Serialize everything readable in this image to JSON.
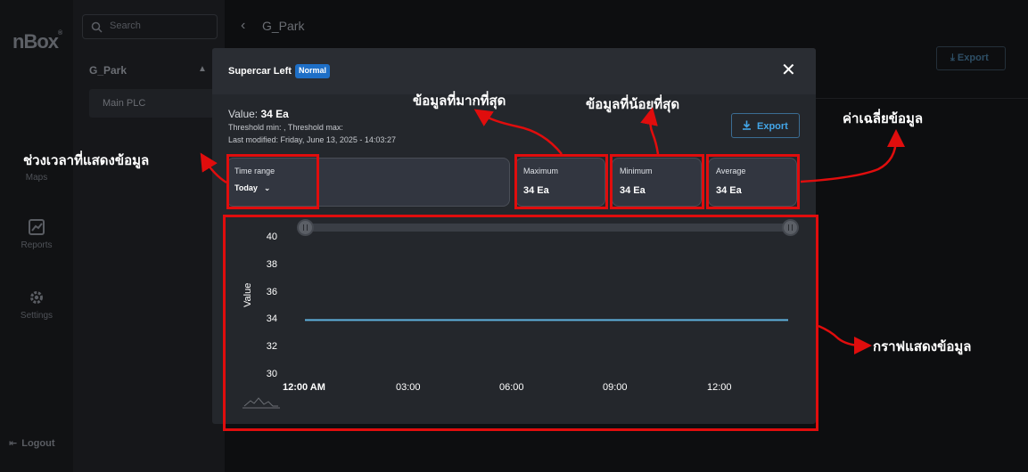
{
  "app": {
    "logo": "nBox",
    "logo_mark": "®",
    "rail": [
      {
        "label": "Maps",
        "icon": "map-icon"
      },
      {
        "label": "Reports",
        "icon": "chart-icon"
      },
      {
        "label": "Settings",
        "icon": "gear-icon"
      }
    ],
    "logout_label": "Logout"
  },
  "sidebar": {
    "search_placeholder": "Search",
    "group": "G_Park",
    "item": "Main PLC"
  },
  "topbar": {
    "title": "G_Park",
    "export_label": "Export"
  },
  "modal": {
    "title": "Supercar Left",
    "status_badge": "Normal",
    "value_prefix": "Value:",
    "value": "34 Ea",
    "threshold": "Threshold min: , Threshold max:",
    "last_modified": "Last modified: Friday, June 13, 2025 - 14:03:27",
    "export_label": "Export",
    "time_range_label": "Time range",
    "time_range_value": "Today",
    "maximum_label": "Maximum",
    "maximum_value": "34 Ea",
    "minimum_label": "Minimum",
    "minimum_value": "34 Ea",
    "average_label": "Average",
    "average_value": "34 Ea"
  },
  "annotations": {
    "time_range": "ช่วงเวลาที่แสดงข้อมูล",
    "maximum": "ข้อมูลที่มากที่สุด",
    "minimum": "ข้อมูลที่น้อยที่สุด",
    "average": "ค่าเฉลี่ยข้อมูล",
    "chart": "กราฟแสดงข้อมูล"
  },
  "colors": {
    "accent": "#1e6fc7",
    "line": "#5eb0dc",
    "highlight": "#e00d0d"
  },
  "chart_data": {
    "type": "line",
    "x": [
      "12:00 AM",
      "03:00",
      "06:00",
      "09:00",
      "12:00"
    ],
    "ylabel": "Value",
    "yticks": [
      40,
      38,
      36,
      34,
      32,
      30
    ],
    "ylim": [
      30,
      40
    ],
    "series": [
      {
        "values": [
          34,
          34
        ]
      }
    ],
    "grid": false
  }
}
